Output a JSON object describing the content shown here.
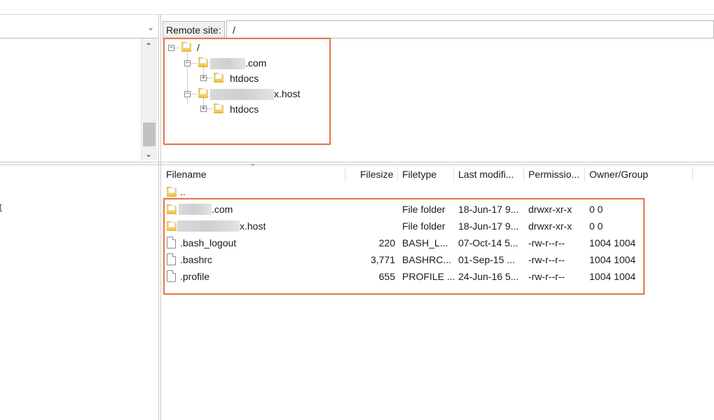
{
  "remote_site": {
    "label": "Remote site:",
    "path": "/"
  },
  "remote_tree": {
    "root": "/",
    "nodes": [
      {
        "label": ".com",
        "children": [
          {
            "label": "htdocs"
          }
        ]
      },
      {
        "label": "x.host",
        "children": [
          {
            "label": "htdocs"
          }
        ]
      }
    ]
  },
  "file_list": {
    "columns": [
      "Filename",
      "Filesize",
      "Filetype",
      "Last modifi...",
      "Permissio...",
      "Owner/Group"
    ],
    "parent_dir": "..",
    "rows": [
      {
        "name": ".com",
        "size": "",
        "type": "File folder",
        "modified": "18-Jun-17 9...",
        "perms": "drwxr-xr-x",
        "owner": "0 0",
        "icon": "folder-icon"
      },
      {
        "name": "x.host",
        "size": "",
        "type": "File folder",
        "modified": "18-Jun-17 9...",
        "perms": "drwxr-xr-x",
        "owner": "0 0",
        "icon": "folder-icon"
      },
      {
        "name": ".bash_logout",
        "size": "220",
        "type": "BASH_L...",
        "modified": "07-Oct-14 5...",
        "perms": "-rw-r--r--",
        "owner": "1004 1004",
        "icon": "file-icon"
      },
      {
        "name": ".bashrc",
        "size": "3,771",
        "type": "BASHRC...",
        "modified": "01-Sep-15 ...",
        "perms": "-rw-r--r--",
        "owner": "1004 1004",
        "icon": "file-icon"
      },
      {
        "name": ".profile",
        "size": "655",
        "type": "PROFILE ...",
        "modified": "24-Jun-16 5...",
        "perms": "-rw-r--r--",
        "owner": "1004 1004",
        "icon": "file-icon"
      }
    ]
  },
  "colors": {
    "highlight": "#e8774a",
    "folder": "#f5cd57"
  }
}
